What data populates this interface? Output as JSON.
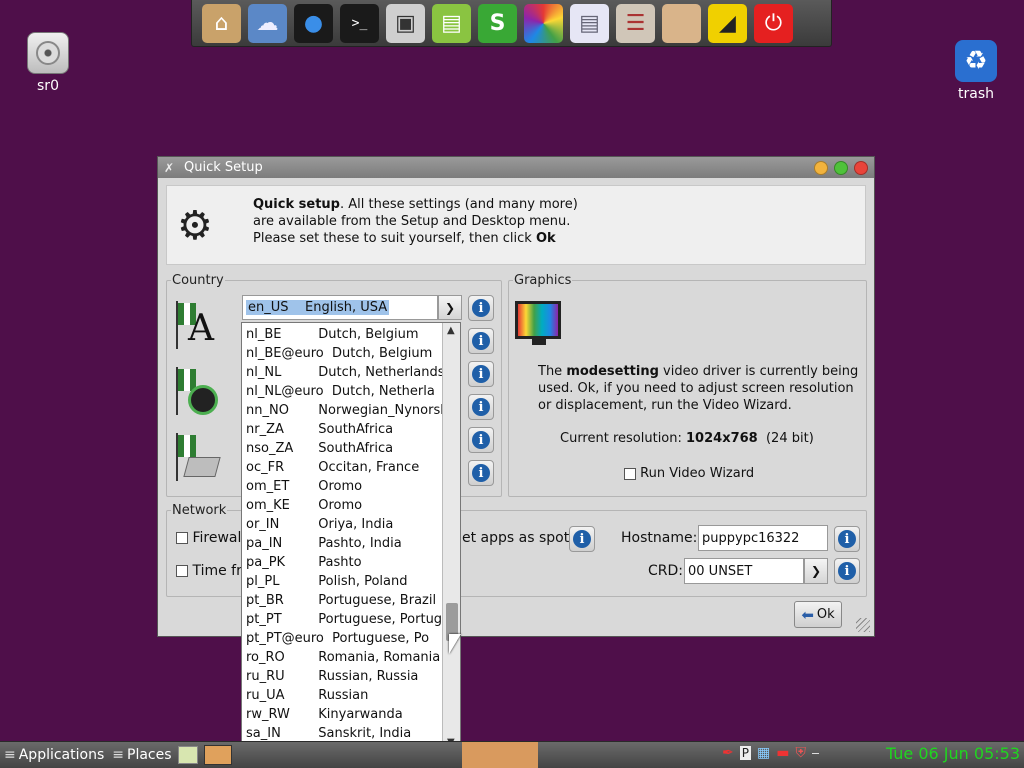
{
  "dock": {
    "items": [
      {
        "icon": "home-folder-icon",
        "color": "#c9a26a"
      },
      {
        "icon": "cloud-icon",
        "color": "#dfe9f7"
      },
      {
        "icon": "chat-icon",
        "color": "#1e6fd0"
      },
      {
        "icon": "terminal-icon",
        "color": "#222222",
        "glyph": ">_"
      },
      {
        "icon": "monitor-icon",
        "color": "#bcbcbc"
      },
      {
        "icon": "document-icon",
        "color": "#8ac441"
      },
      {
        "icon": "spreadsheet-icon",
        "color": "#39a835",
        "glyph": "S"
      },
      {
        "icon": "color-wheel-icon",
        "color": "#e84d3a"
      },
      {
        "icon": "text-file-icon",
        "color": "#e6e6f5"
      },
      {
        "icon": "mixer-icon",
        "color": "#d0c6b8"
      },
      {
        "icon": "folder-icon",
        "color": "#d9b48a"
      },
      {
        "icon": "ruler-icon",
        "color": "#f0d000"
      },
      {
        "icon": "power-icon",
        "color": "#e52020"
      }
    ]
  },
  "desktop": {
    "sr0_label": "sr0",
    "trash_label": "trash"
  },
  "window": {
    "title": "Quick Setup",
    "header": {
      "bold_lead": "Quick setup",
      "line1_rest": ". All these settings (and many more)",
      "line2": "are available from the Setup and Desktop menu.",
      "line3_prefix": "Please set these to suit yourself, then click ",
      "line3_bold": "Ok"
    },
    "country": {
      "legend": "Country",
      "locale_code": "en_US",
      "locale_name": "English, USA"
    },
    "graphics": {
      "legend": "Graphics",
      "text_prefix": "The ",
      "driver": "modesetting",
      "text_rest1": " video driver is currently being",
      "line2": "used. Ok, if you need to adjust screen resolution",
      "line3": "or displacement, run the Video Wizard.",
      "res_label": "Current resolution: ",
      "res_value": "1024x768",
      "res_depth": "  (24 bit)",
      "wizard_label": "Run Video Wizard"
    },
    "network": {
      "legend": "Network",
      "firewall_label": "Firewall",
      "time_label": "Time fro",
      "apps_spot_label": "et apps as spot",
      "hostname_label": "Hostname:",
      "hostname_value": "puppypc16322",
      "crd_label": "CRD:",
      "crd_value": "00 UNSET"
    },
    "ok_label": "Ok"
  },
  "dropdown": {
    "rows": [
      {
        "code": "nl_BE",
        "name": "Dutch, Belgium"
      },
      {
        "code": "nl_BE@euro",
        "name": "Dutch, Belgium"
      },
      {
        "code": "nl_NL",
        "name": "Dutch, Netherlands"
      },
      {
        "code": "nl_NL@euro",
        "name": "Dutch, Netherla"
      },
      {
        "code": "nn_NO",
        "name": "Norwegian_Nynorsk"
      },
      {
        "code": "nr_ZA",
        "name": "SouthAfrica"
      },
      {
        "code": "nso_ZA",
        "name": "SouthAfrica"
      },
      {
        "code": "oc_FR",
        "name": "Occitan, France"
      },
      {
        "code": "om_ET",
        "name": "Oromo"
      },
      {
        "code": "om_KE",
        "name": "Oromo"
      },
      {
        "code": "or_IN",
        "name": "Oriya, India"
      },
      {
        "code": "pa_IN",
        "name": "Pashto, India"
      },
      {
        "code": "pa_PK",
        "name": "Pashto"
      },
      {
        "code": "pl_PL",
        "name": "Polish, Poland"
      },
      {
        "code": "pt_BR",
        "name": "Portuguese, Brazil"
      },
      {
        "code": "pt_PT",
        "name": "Portuguese, Portuga"
      },
      {
        "code": "pt_PT@euro",
        "name": "Portuguese, Po"
      },
      {
        "code": "ro_RO",
        "name": "Romania, Romania"
      },
      {
        "code": "ru_RU",
        "name": "Russian, Russia"
      },
      {
        "code": "ru_UA",
        "name": "Russian"
      },
      {
        "code": "rw_RW",
        "name": "Kinyarwanda"
      },
      {
        "code": "sa_IN",
        "name": "Sanskrit, India"
      }
    ]
  },
  "taskbar": {
    "applications_label": "Applications",
    "places_label": "Places",
    "clock": "Tue 06 Jun 05:53"
  }
}
